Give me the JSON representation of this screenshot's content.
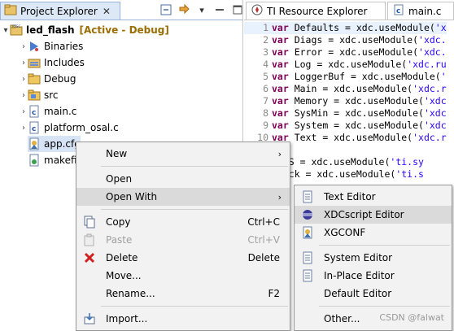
{
  "explorer": {
    "tab_label": "Project Explorer",
    "tab_close": "✕",
    "project_name": "led_flash",
    "project_status": "[Active - Debug]",
    "items": [
      {
        "label": "Binaries"
      },
      {
        "label": "Includes"
      },
      {
        "label": "Debug"
      },
      {
        "label": "src"
      },
      {
        "label": "main.c"
      },
      {
        "label": "platform_osal.c"
      },
      {
        "label": "app.cfg"
      },
      {
        "label": "makefile"
      }
    ]
  },
  "editor": {
    "tabs": [
      {
        "label": "TI Resource Explorer"
      },
      {
        "label": "main.c"
      }
    ],
    "lines": [
      {
        "num": "1",
        "kw": "var",
        "text": " Defaults = xdc.useModule(",
        "str": "'x"
      },
      {
        "num": "2",
        "kw": "var",
        "text": " Diags = xdc.useModule(",
        "str": "'xdc."
      },
      {
        "num": "3",
        "kw": "var",
        "text": " Error = xdc.useModule(",
        "str": "'xdc."
      },
      {
        "num": "4",
        "kw": "var",
        "text": " Log = xdc.useModule(",
        "str": "'xdc.ru"
      },
      {
        "num": "5",
        "kw": "var",
        "text": " LoggerBuf = xdc.useModule(",
        "str": "'"
      },
      {
        "num": "6",
        "kw": "var",
        "text": " Main = xdc.useModule(",
        "str": "'xdc.r"
      },
      {
        "num": "7",
        "kw": "var",
        "text": " Memory = xdc.useModule(",
        "str": "'xdc"
      },
      {
        "num": "8",
        "kw": "var",
        "text": " SysMin = xdc.useModule(",
        "str": "'xdc"
      },
      {
        "num": "9",
        "kw": "var",
        "text": " System = xdc.useModule(",
        "str": "'xdc"
      },
      {
        "num": "10",
        "kw": "var",
        "text": " Text = xdc.useModule(",
        "str": "'xdc.r"
      },
      {
        "num": "",
        "kw": "",
        "text": "",
        "str": ""
      },
      {
        "num": "",
        "kw": "",
        "text": "BIOS = xdc.useModule(",
        "str": "'ti.sy"
      },
      {
        "num": "",
        "kw": "",
        "text": "Clock = xdc.useModule(",
        "str": "'ti.s"
      },
      {
        "num": "",
        "kw": "",
        "text": "",
        "str": ""
      }
    ]
  },
  "context_menu": {
    "new": "New",
    "open": "Open",
    "open_with": "Open With",
    "copy": "Copy",
    "copy_shortcut": "Ctrl+C",
    "paste": "Paste",
    "paste_shortcut": "Ctrl+V",
    "delete": "Delete",
    "delete_shortcut": "Delete",
    "move": "Move...",
    "rename": "Rename...",
    "rename_shortcut": "F2",
    "import": "Import..."
  },
  "open_with_menu": {
    "text_editor": "Text Editor",
    "xdcscript_editor": "XDCscript Editor",
    "xgconf": "XGCONF",
    "system_editor": "System Editor",
    "in_place_editor": "In-Place Editor",
    "default_editor": "Default Editor",
    "other": "Other..."
  },
  "watermark": "CSDN @falwat",
  "colors": {
    "project_status": "#9a6d00",
    "tab_active_bg": "#dde8f6",
    "menu_bg": "#f2f2f2",
    "menu_highlight": "#dadada",
    "keyword": "#7f0055",
    "string": "#2a00ff"
  }
}
